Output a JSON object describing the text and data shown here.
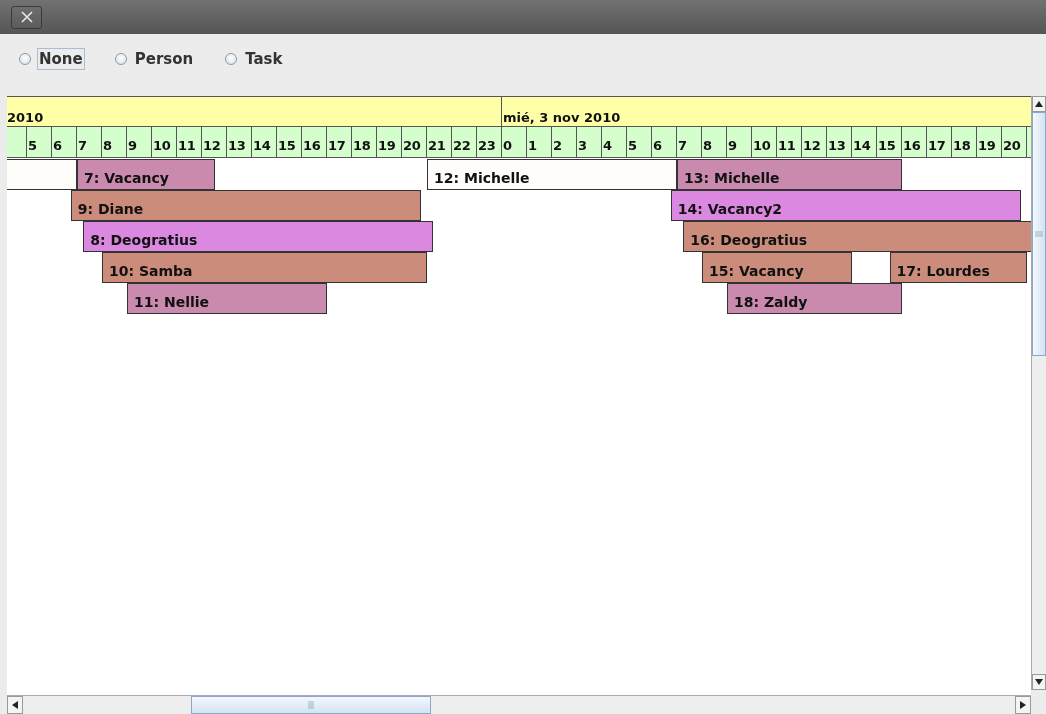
{
  "radio_group": [
    {
      "label": "None",
      "selected": false,
      "focused": true
    },
    {
      "label": "Person",
      "selected": false,
      "focused": false
    },
    {
      "label": "Task",
      "selected": false,
      "focused": false
    }
  ],
  "timeline": {
    "days": [
      {
        "label": "2010",
        "hours": [
          "5",
          "6",
          "7",
          "8",
          "9",
          "10",
          "11",
          "12",
          "13",
          "14",
          "15",
          "16",
          "17",
          "18",
          "19",
          "20",
          "21",
          "22",
          "23"
        ]
      },
      {
        "label": "mié, 3 nov 2010",
        "hours": [
          "0",
          "1",
          "2",
          "3",
          "4",
          "5",
          "6",
          "7",
          "8",
          "9",
          "10",
          "11",
          "12",
          "13",
          "14",
          "15",
          "16",
          "17",
          "18",
          "19",
          "20"
        ]
      }
    ],
    "lanes": [
      [
        {
          "color": "#fffdf9"
        },
        {
          "label": "7: Vacancy",
          "color": "#c98aad"
        },
        {
          "label": "12: Michelle",
          "color": "#fffdf9"
        },
        {
          "label": "13: Michelle",
          "color": "#c98aad"
        }
      ],
      [
        {
          "label": "9: Diane",
          "color": "#cc8c7c"
        },
        {
          "label": "14: Vacancy2",
          "color": "#da88e0"
        }
      ],
      [
        {
          "label": "8: Deogratius",
          "color": "#da88e0"
        },
        {
          "label": "16: Deogratius",
          "color": "#cc8c7c"
        }
      ],
      [
        {
          "label": "10: Samba",
          "color": "#cc8c7c"
        },
        {
          "label": "15: Vacancy",
          "color": "#cc8c7c"
        },
        {
          "label": "17: Lourdes",
          "color": "#cc8c7c"
        }
      ],
      [
        {
          "label": "11: Nellie",
          "color": "#c98aad"
        },
        {
          "label": "18: Zaldy",
          "color": "#c98aad"
        }
      ]
    ]
  }
}
